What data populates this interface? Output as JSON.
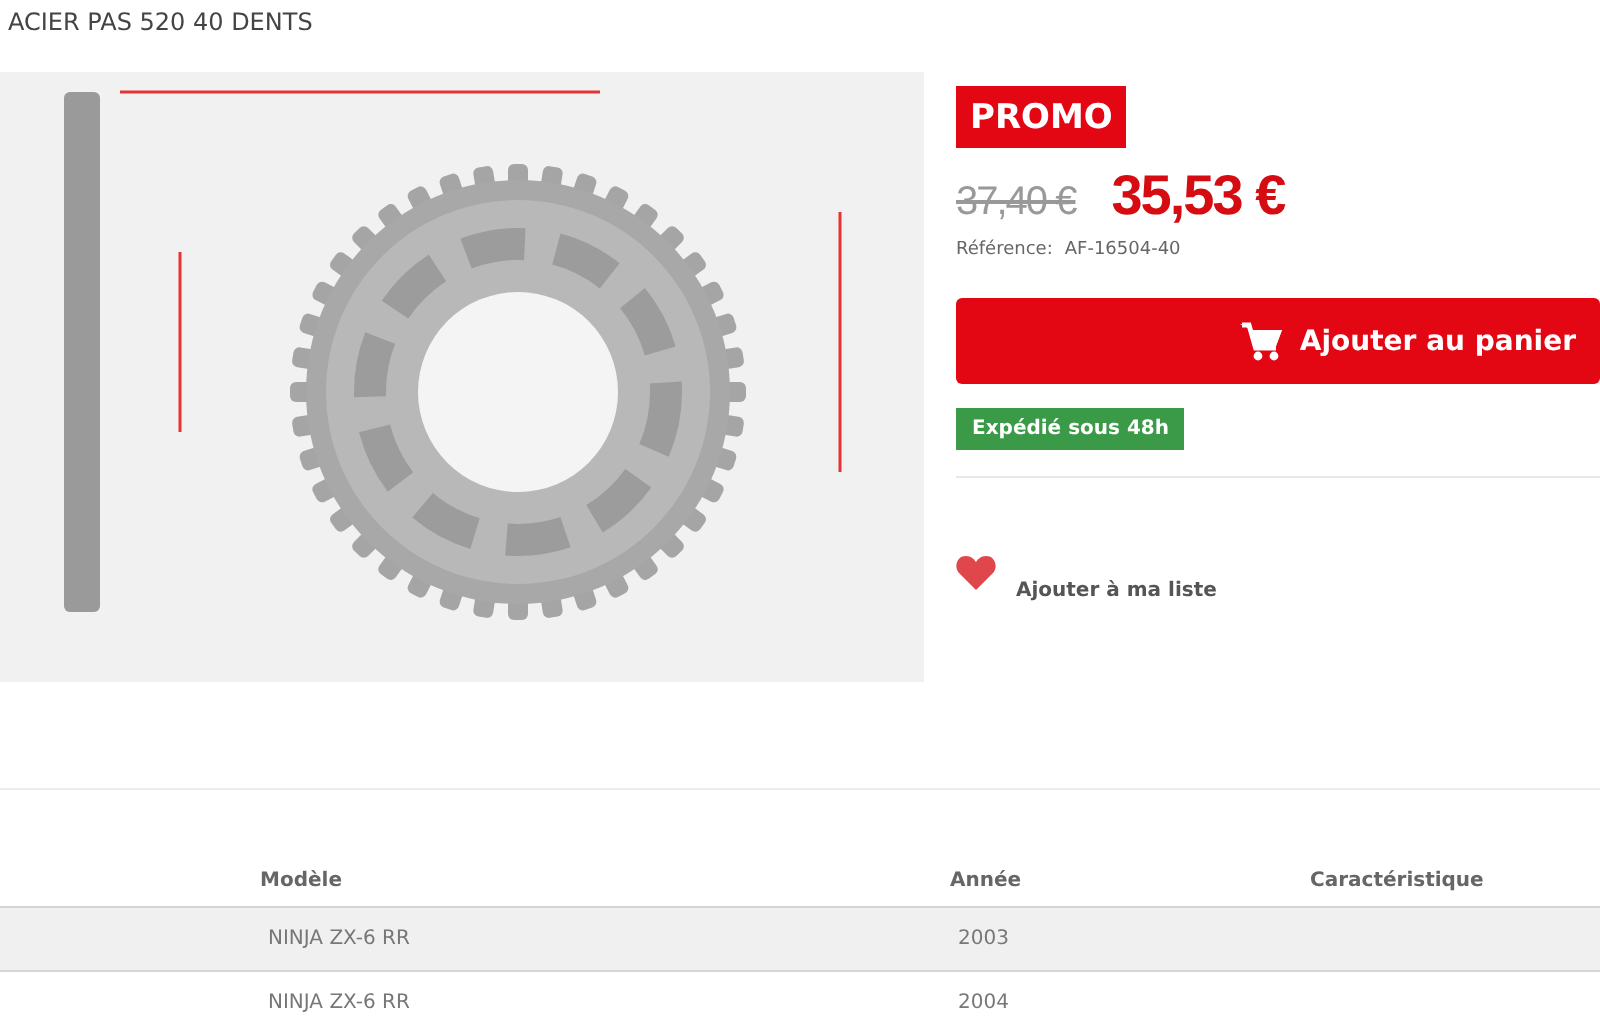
{
  "title": "ACIER PAS 520 40 DENTS",
  "badge": "PROMO",
  "old_price": "37,40 €",
  "price": "35,53 €",
  "reference": {
    "label": "Référence:",
    "value": "AF-16504-40"
  },
  "add_to_cart": "Ajouter au panier",
  "shipping": "Expédié sous 48h",
  "wishlist": "Ajouter à ma liste",
  "table": {
    "columns": [
      "Modèle",
      "Année",
      "Caractéristique"
    ],
    "rows": [
      {
        "model": "NINJA ZX-6 RR",
        "year": "2003"
      },
      {
        "model": "NINJA ZX-6 RR",
        "year": "2004"
      }
    ]
  }
}
